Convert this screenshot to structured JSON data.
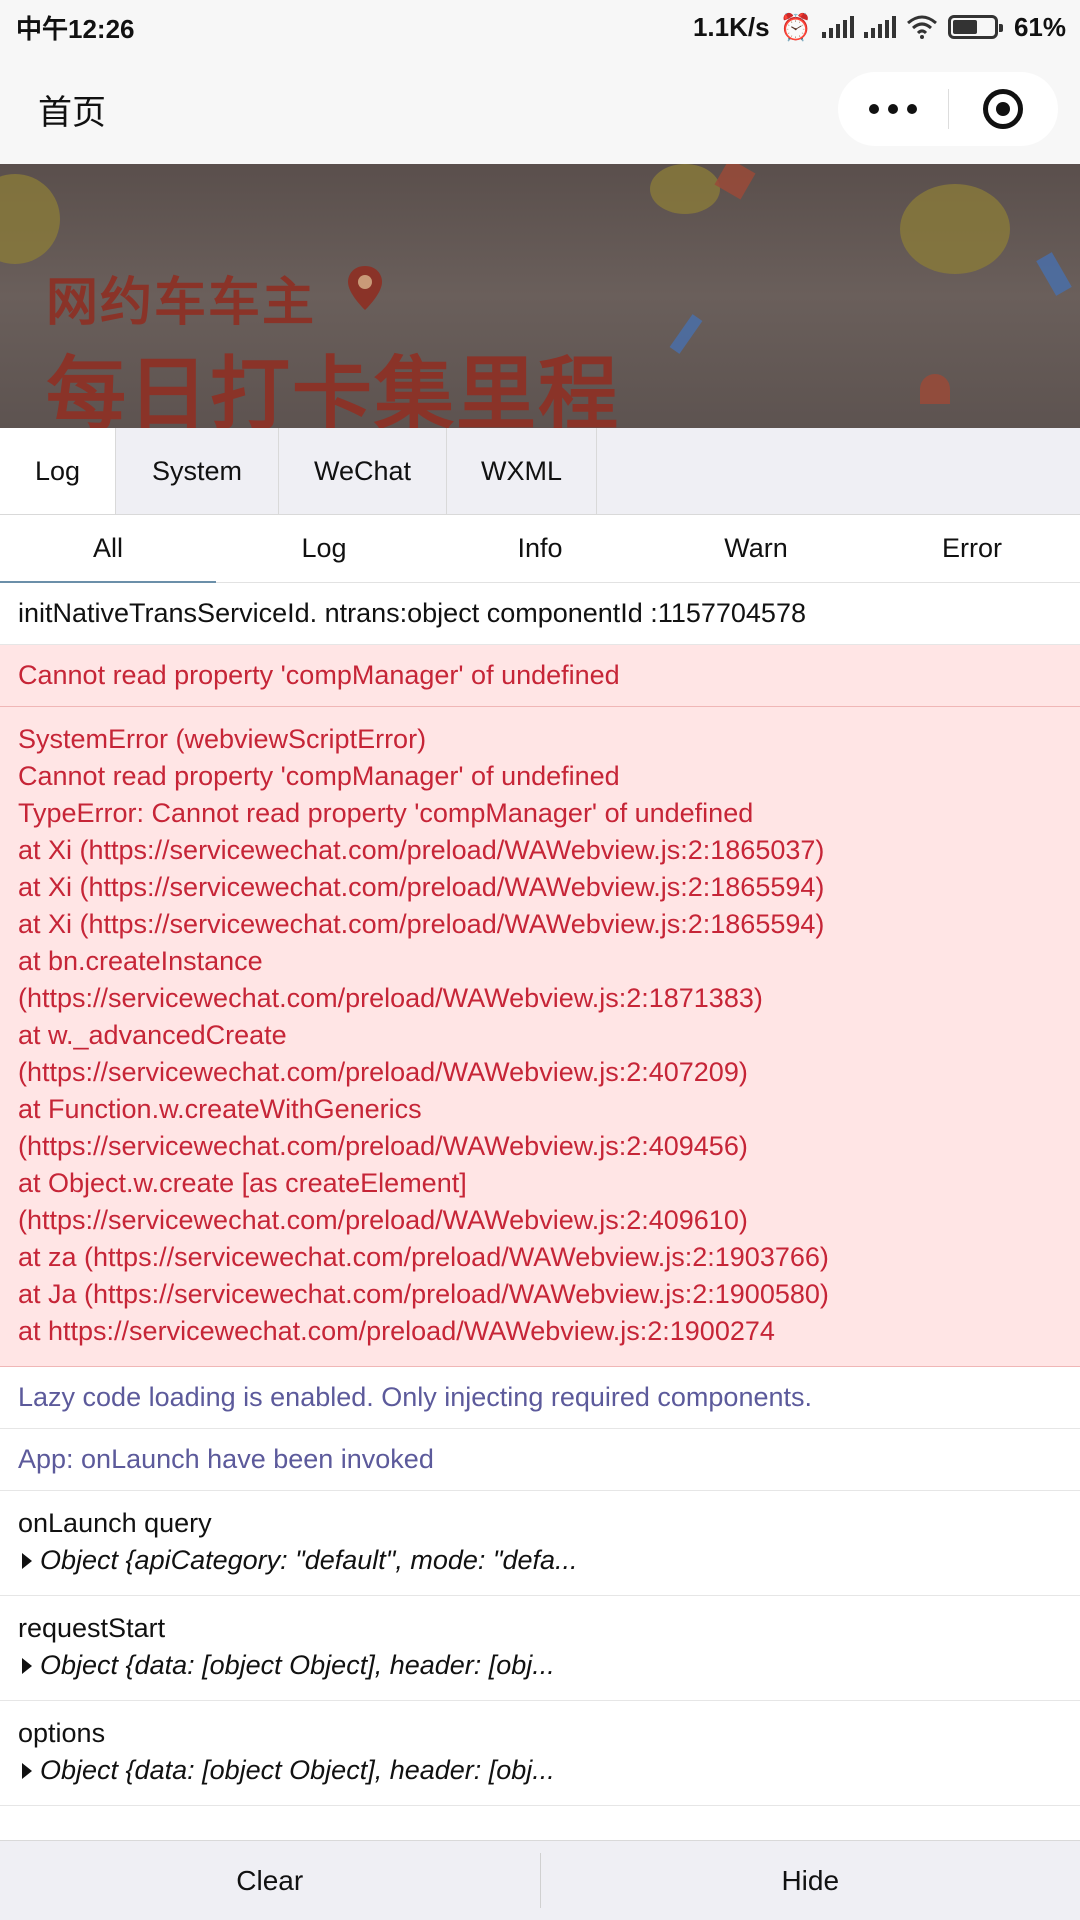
{
  "status_bar": {
    "time": "中午12:26",
    "net_speed": "1.1K/s",
    "battery_pct_text": "61%",
    "battery_level": 0.61,
    "icons": [
      "alarm-icon",
      "signal-icon",
      "hd-signal-icon",
      "wifi-icon",
      "battery-icon"
    ]
  },
  "nav": {
    "title": "首页",
    "menu_icon": "more-dots-icon",
    "close_icon": "target-circle-icon"
  },
  "banner": {
    "line1": "网约车车主",
    "line2": "每日打卡集里程"
  },
  "console": {
    "main_tabs": [
      {
        "label": "Log",
        "active": true
      },
      {
        "label": "System",
        "active": false
      },
      {
        "label": "WeChat",
        "active": false
      },
      {
        "label": "WXML",
        "active": false
      }
    ],
    "filter_tabs": [
      {
        "label": "All",
        "active": true
      },
      {
        "label": "Log",
        "active": false
      },
      {
        "label": "Info",
        "active": false
      },
      {
        "label": "Warn",
        "active": false
      },
      {
        "label": "Error",
        "active": false
      }
    ],
    "entries": [
      {
        "level": "log",
        "lines": [
          "initNativeTransServiceId. ntrans:object componentId :1157704578"
        ]
      },
      {
        "level": "error",
        "lines": [
          "Cannot read property 'compManager' of undefined"
        ]
      },
      {
        "level": "error",
        "lines": [
          "SystemError (webviewScriptError)",
          "Cannot read property 'compManager' of undefined",
          "TypeError: Cannot read property 'compManager' of undefined",
          "at Xi (https://servicewechat.com/preload/WAWebview.js:2:1865037)",
          "at Xi (https://servicewechat.com/preload/WAWebview.js:2:1865594)",
          "at Xi (https://servicewechat.com/preload/WAWebview.js:2:1865594)",
          "at bn.createInstance",
          "(https://servicewechat.com/preload/WAWebview.js:2:1871383)",
          "at w._advancedCreate",
          "(https://servicewechat.com/preload/WAWebview.js:2:407209)",
          "at Function.w.createWithGenerics",
          "(https://servicewechat.com/preload/WAWebview.js:2:409456)",
          "at Object.w.create [as createElement]",
          "(https://servicewechat.com/preload/WAWebview.js:2:409610)",
          "at za (https://servicewechat.com/preload/WAWebview.js:2:1903766)",
          "at Ja (https://servicewechat.com/preload/WAWebview.js:2:1900580)",
          "at https://servicewechat.com/preload/WAWebview.js:2:1900274"
        ]
      },
      {
        "level": "info",
        "lines": [
          "Lazy code loading is enabled. Only injecting required components."
        ]
      },
      {
        "level": "info",
        "lines": [
          "App: onLaunch have been invoked"
        ]
      },
      {
        "level": "log",
        "lines": [
          "onLaunch query"
        ],
        "object": "Object {apiCategory: \"default\", mode: \"defa..."
      },
      {
        "level": "log",
        "lines": [
          "requestStart"
        ],
        "object": "Object {data: [object Object], header: [obj..."
      },
      {
        "level": "log",
        "lines": [
          "options"
        ],
        "object": "Object {data: [object Object], header: [obj..."
      }
    ],
    "footer": {
      "clear": "Clear",
      "hide": "Hide"
    }
  }
}
